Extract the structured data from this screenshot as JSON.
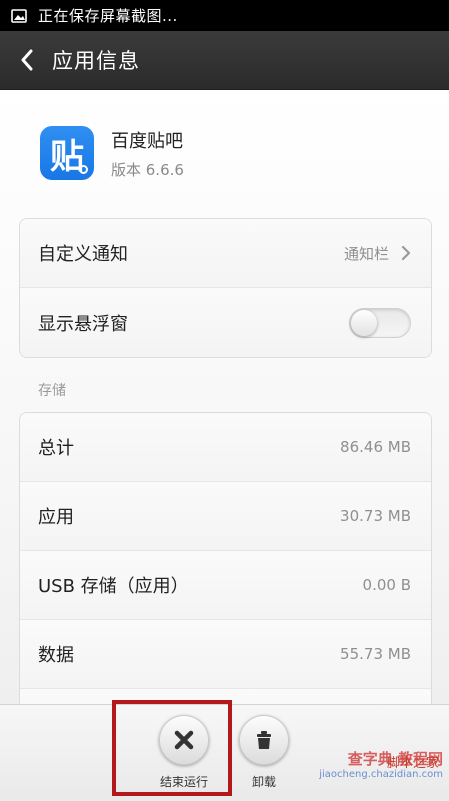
{
  "statusbar": {
    "icon": "image-icon",
    "text": "正在保存屏幕截图..."
  },
  "titlebar": {
    "back_icon": "chevron-left-icon",
    "title": "应用信息"
  },
  "app": {
    "icon_char": "贴",
    "name": "百度贴吧",
    "version": "版本 6.6.6",
    "icon_color": "#1b7ce8"
  },
  "settings": {
    "notify_label": "自定义通知",
    "notify_value": "通知栏",
    "float_label": "显示悬浮窗",
    "float_enabled": false
  },
  "storage": {
    "section_label": "存储",
    "rows": [
      {
        "label": "总计",
        "value": "86.46 MB"
      },
      {
        "label": "应用",
        "value": "30.73 MB"
      },
      {
        "label": "USB 存储（应用）",
        "value": "0.00 B"
      },
      {
        "label": "数据",
        "value": "55.73 MB"
      }
    ]
  },
  "actions": {
    "stop_label": "结束运行",
    "uninstall_label": "卸载"
  },
  "watermark": {
    "line1": "查字典 教程网",
    "line2": "jiaocheng.chazidian.com",
    "right_text": "脚本之家"
  },
  "colors": {
    "highlight": "#b31919",
    "titlebar": "#333333"
  }
}
